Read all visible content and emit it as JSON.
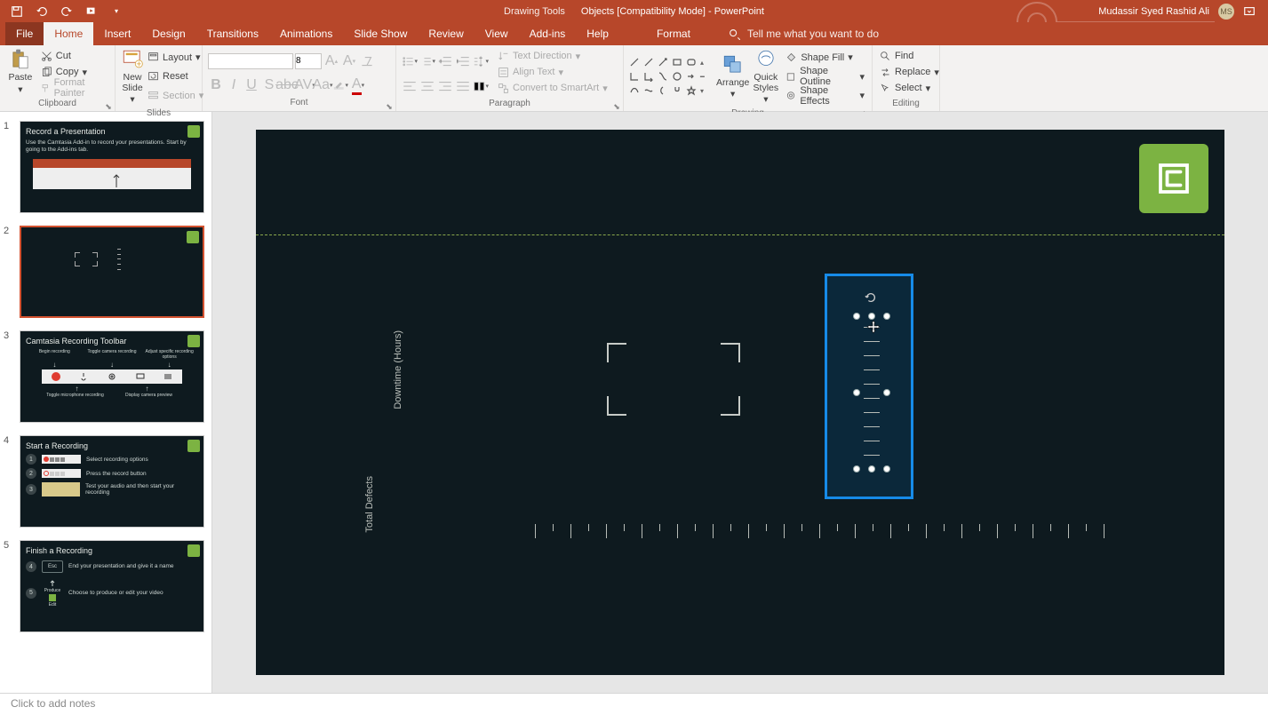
{
  "titlebar": {
    "drawing_tools": "Drawing Tools",
    "doc_title": "Objects [Compatibility Mode]  -  PowerPoint",
    "user": "Mudassir Syed Rashid Ali",
    "avatar": "MS"
  },
  "tabs": {
    "file": "File",
    "home": "Home",
    "insert": "Insert",
    "design": "Design",
    "transitions": "Transitions",
    "animations": "Animations",
    "slideshow": "Slide Show",
    "review": "Review",
    "view": "View",
    "addins": "Add-ins",
    "help": "Help",
    "format": "Format",
    "tellme": "Tell me what you want to do"
  },
  "ribbon": {
    "clipboard": {
      "label": "Clipboard",
      "paste": "Paste",
      "cut": "Cut",
      "copy": "Copy",
      "painter": "Format Painter"
    },
    "slides": {
      "label": "Slides",
      "new": "New\nSlide",
      "layout": "Layout",
      "reset": "Reset",
      "section": "Section"
    },
    "font": {
      "label": "Font",
      "name": "",
      "size": "8"
    },
    "paragraph": {
      "label": "Paragraph",
      "textdir": "Text Direction",
      "align": "Align Text",
      "smartart": "Convert to SmartArt"
    },
    "drawing": {
      "label": "Drawing",
      "arrange": "Arrange",
      "quick": "Quick\nStyles",
      "fill": "Shape Fill",
      "outline": "Shape Outline",
      "effects": "Shape Effects"
    },
    "editing": {
      "label": "Editing",
      "find": "Find",
      "replace": "Replace",
      "select": "Select"
    }
  },
  "thumbs": [
    {
      "num": "1",
      "title": "Record a Presentation",
      "sub": "Use the Camtasia Add-in to record your presentations. Start by going to the Add-ins tab."
    },
    {
      "num": "2",
      "title": "",
      "sub": ""
    },
    {
      "num": "3",
      "title": "Camtasia Recording Toolbar",
      "sub": ""
    },
    {
      "num": "4",
      "title": "Start a Recording",
      "sub": ""
    },
    {
      "num": "5",
      "title": "Finish a Recording",
      "sub": ""
    }
  ],
  "thumb3": {
    "c1": "Begin recording",
    "c2": "Toggle camera recording",
    "c3": "Adjust specific recording options",
    "b1": "Toggle microphone recording",
    "b2": "Display camera preview"
  },
  "thumb4": {
    "r1": "Select recording options",
    "r2": "Press the record button",
    "r3": "Test your audio and then start your recording"
  },
  "thumb5": {
    "r1": "End your presentation and give it a name",
    "r2": "Choose to produce or edit your video",
    "produce": "Produce",
    "edit": "Edit"
  },
  "slide": {
    "vtext1": "Downtime (Hours)",
    "vtext2": "Total Defects"
  },
  "notes": {
    "placeholder": "Click to add notes"
  }
}
